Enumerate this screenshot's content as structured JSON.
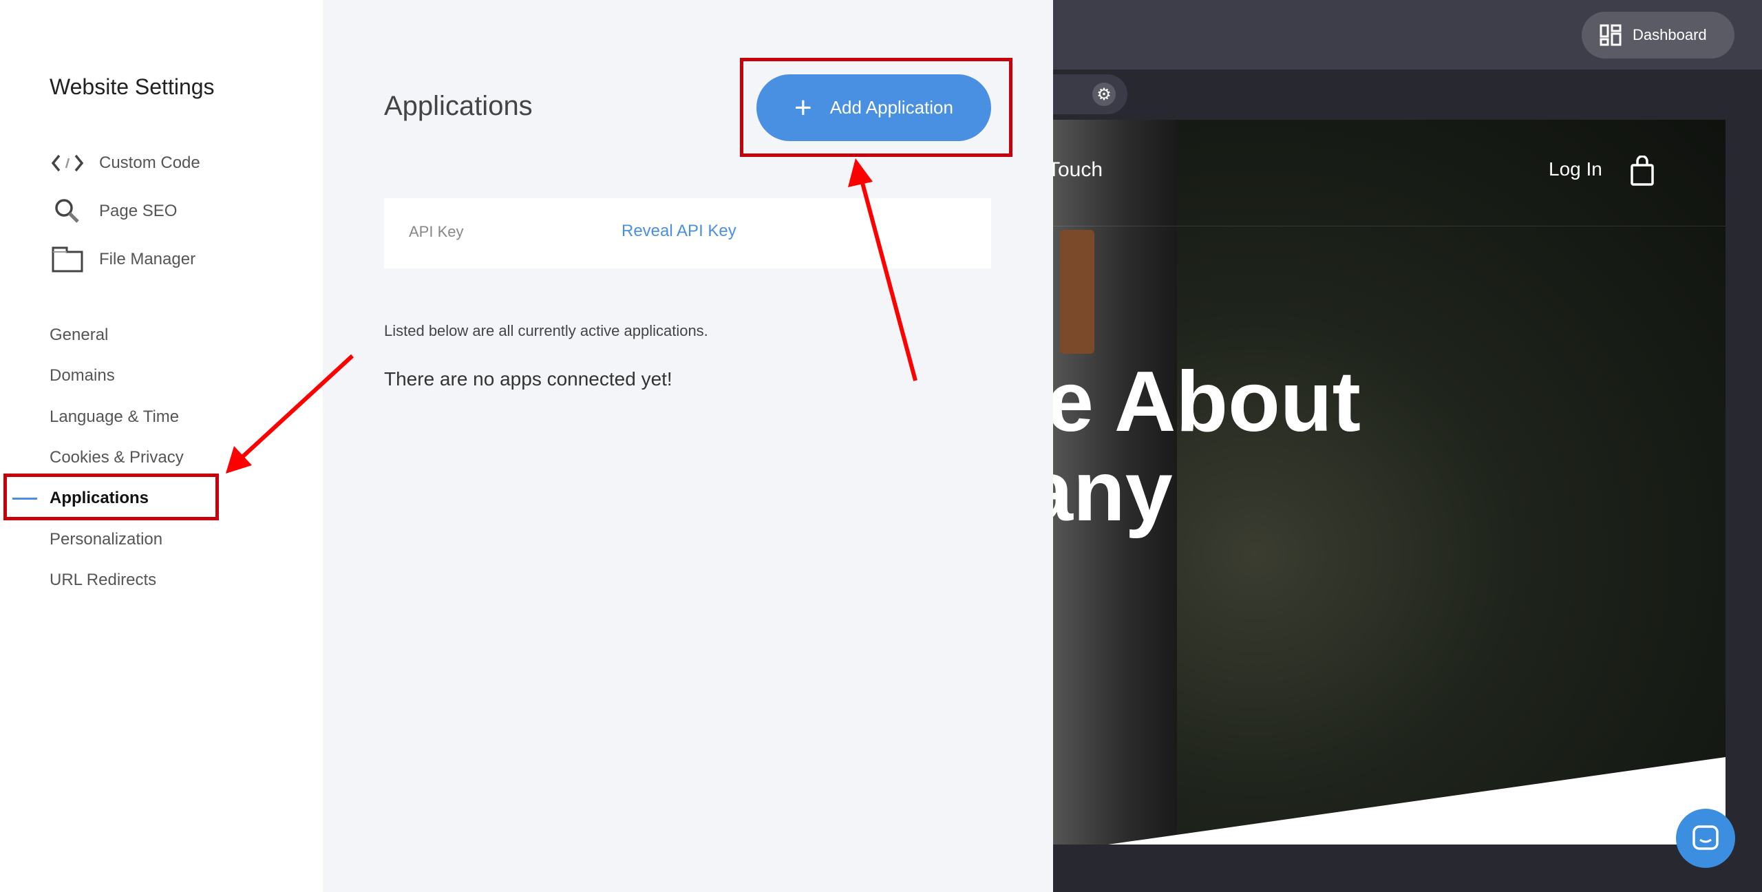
{
  "sidebar": {
    "title": "Website Settings",
    "tools": [
      {
        "label": "Custom Code",
        "icon": "code-icon"
      },
      {
        "label": "Page SEO",
        "icon": "search-icon"
      },
      {
        "label": "File Manager",
        "icon": "folder-icon"
      }
    ],
    "items": [
      {
        "label": "General"
      },
      {
        "label": "Domains"
      },
      {
        "label": "Language & Time"
      },
      {
        "label": "Cookies & Privacy"
      },
      {
        "label": "Applications",
        "active": true
      },
      {
        "label": "Personalization"
      },
      {
        "label": "URL Redirects"
      }
    ]
  },
  "main": {
    "title": "Applications",
    "add_button": "Add Application",
    "api_key_label": "API Key",
    "api_key_action": "Reveal API Key",
    "listed_text": "Listed below are all currently active applications.",
    "empty_text": "There are no apps connected yet!"
  },
  "topbar": {
    "dashboard_label": "Dashboard"
  },
  "preview": {
    "nav_partial": "Touch",
    "login": "Log In",
    "headline_line1": "e About",
    "headline_line2": "any"
  },
  "colors": {
    "accent": "#4a90e2",
    "annotation": "#c8000a",
    "topbar": "#3d3e4a"
  }
}
